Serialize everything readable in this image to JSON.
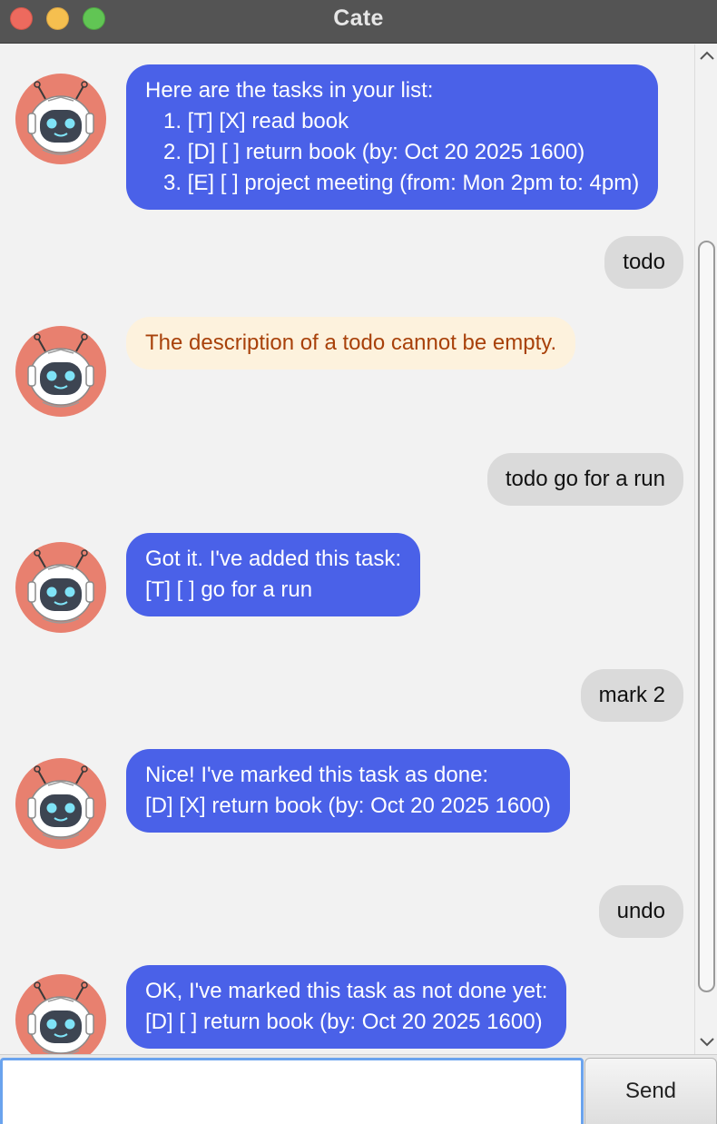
{
  "window": {
    "title": "Cate"
  },
  "messages": {
    "m1": {
      "lines": [
        "Here are the tasks in your list:",
        "1. [T] [X] read book",
        "2. [D] [ ] return book (by: Oct 20 2025 1600)",
        "3. [E] [ ] project meeting (from: Mon 2pm to: 4pm)"
      ]
    },
    "m2": {
      "text": "todo"
    },
    "m3": {
      "text": "The description of a todo cannot be empty."
    },
    "m4": {
      "text": "todo go for a run"
    },
    "m5": {
      "lines": [
        "Got it. I've added this task:",
        "[T] [ ] go for a run"
      ]
    },
    "m6": {
      "text": "mark 2"
    },
    "m7": {
      "lines": [
        "Nice! I've marked this task as done:",
        "[D] [X] return book (by: Oct 20 2025 1600)"
      ]
    },
    "m8": {
      "text": "undo"
    },
    "m9": {
      "lines": [
        "OK, I've marked this task as not done yet:",
        "[D] [ ] return book (by: Oct 20 2025 1600)"
      ]
    }
  },
  "input": {
    "value": "",
    "placeholder": ""
  },
  "send_label": "Send",
  "colors": {
    "bot_bubble": "#4a61e8",
    "error_bubble": "#fdf2dd",
    "error_text": "#a8410a",
    "user_bubble": "#dadada",
    "avatar_bg": "#e8806f"
  },
  "icons": {
    "avatar": "robot-avatar-icon",
    "scroll_up": "chevron-up-icon",
    "scroll_down": "chevron-down-icon"
  }
}
